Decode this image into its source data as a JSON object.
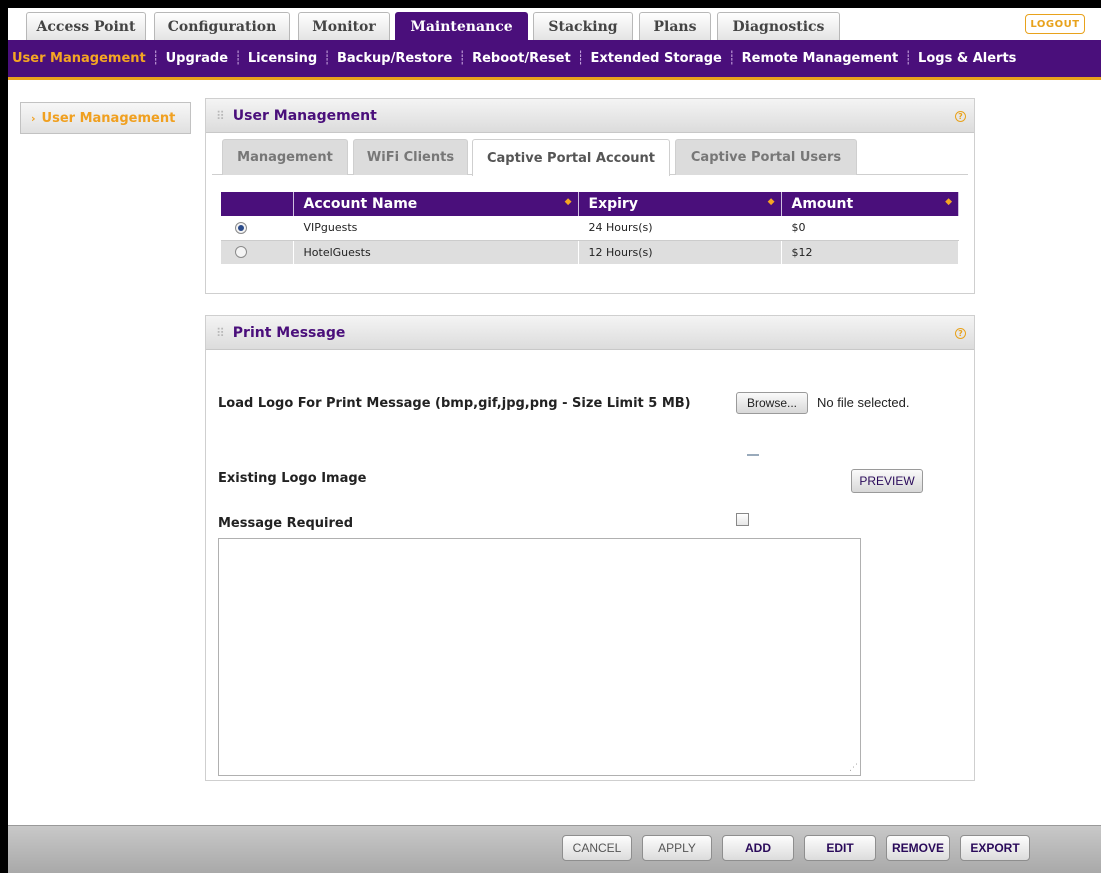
{
  "top_tabs": [
    "Access Point",
    "Configuration",
    "Monitor",
    "Maintenance",
    "Stacking",
    "Plans",
    "Diagnostics"
  ],
  "active_top_tab": "Maintenance",
  "logout_label": "LOGOUT",
  "sub_nav": [
    "User Management",
    "Upgrade",
    "Licensing",
    "Backup/Restore",
    "Reboot/Reset",
    "Extended Storage",
    "Remote Management",
    "Logs & Alerts"
  ],
  "active_sub_nav": "User Management",
  "sidebar": {
    "item": "User Management"
  },
  "user_mgmt": {
    "title": "User Management",
    "tabs": [
      "Management",
      "WiFi Clients",
      "Captive Portal Account",
      "Captive Portal Users"
    ],
    "active_tab": "Captive Portal Account",
    "table": {
      "headers": [
        "Account Name",
        "Expiry",
        "Amount"
      ],
      "rows": [
        {
          "selected": true,
          "name": "VIPguests",
          "expiry": "24 Hours(s)",
          "amount": "$0"
        },
        {
          "selected": false,
          "name": "HotelGuests",
          "expiry": "12 Hours(s)",
          "amount": "$12"
        }
      ]
    }
  },
  "print_msg": {
    "title": "Print Message",
    "load_logo_label": "Load Logo For Print Message (bmp,gif,jpg,png - Size Limit 5 MB)",
    "browse_label": "Browse...",
    "no_file_text": "No file selected.",
    "existing_logo_label": "Existing Logo Image",
    "preview_label": "PREVIEW",
    "message_required_label": "Message Required",
    "message_required_checked": false,
    "message_text": ""
  },
  "footer_buttons": [
    "CANCEL",
    "APPLY",
    "ADD",
    "EDIT",
    "REMOVE",
    "EXPORT"
  ],
  "colors": {
    "brand_purple": "#4a0f7b",
    "accent_orange": "#e8a21c"
  }
}
